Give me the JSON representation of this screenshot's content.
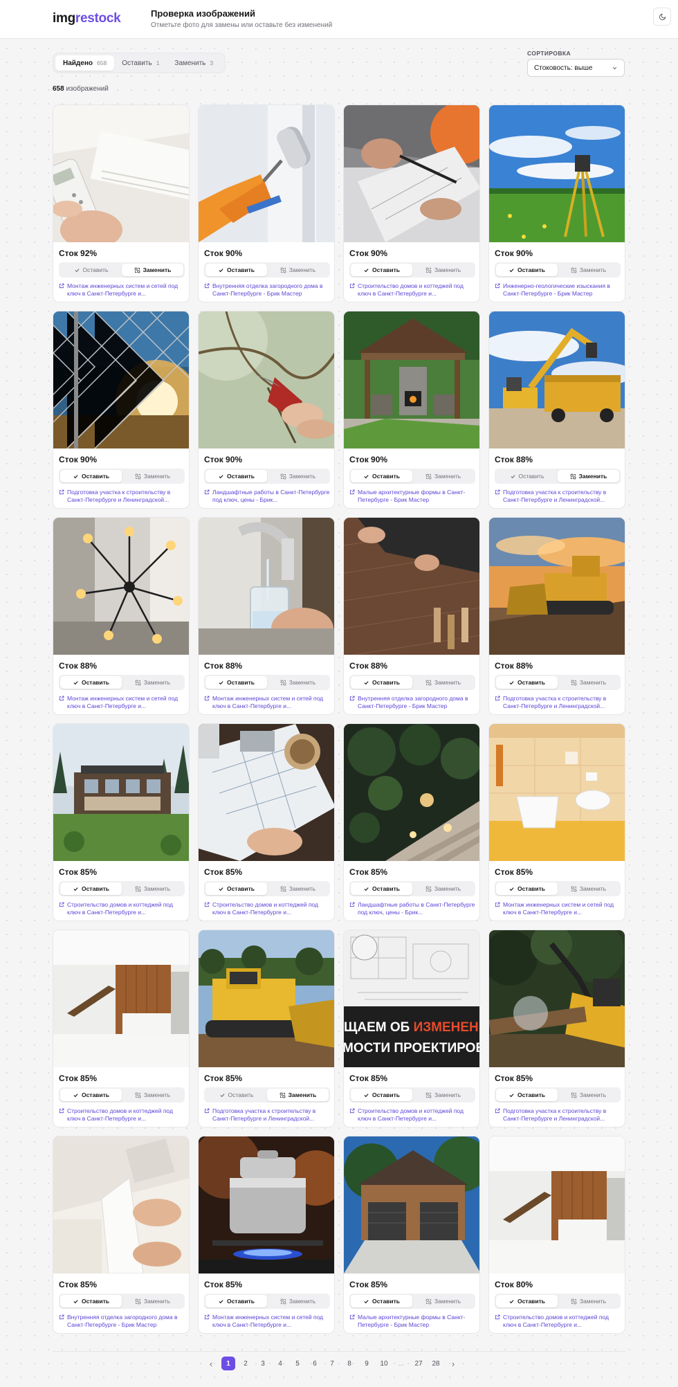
{
  "header": {
    "logo_b": "img",
    "logo_a": "restock",
    "title": "Проверка изображений",
    "subtitle": "Отметьте фото для замены или оставьте без изменений"
  },
  "filters": {
    "tabs": [
      {
        "label": "Найдено",
        "count": "658",
        "active": true
      },
      {
        "label": "Оставить",
        "count": "1",
        "active": false
      },
      {
        "label": "Заменить",
        "count": "3",
        "active": false
      }
    ],
    "sort_label": "СОРТИРОВКА",
    "sort_value": "Стоковость: выше"
  },
  "summary": {
    "count": "658",
    "label": "изображений"
  },
  "labels": {
    "keep": "Оставить",
    "replace": "Заменить"
  },
  "cards": [
    {
      "stock": "Сток 92%",
      "choice": "replace",
      "link": "Монтаж инженерных систем и сетей под ключ в Санкт-Петербурге и...",
      "scene": "ac"
    },
    {
      "stock": "Сток 90%",
      "choice": "keep",
      "link": "Внутренняя отделка загородного дома в Санкт-Петербурге - Брик Мастер",
      "scene": "roller"
    },
    {
      "stock": "Сток 90%",
      "choice": "keep",
      "link": "Строительство домов и коттеджей под ключ в Санкт-Петербурге и...",
      "scene": "plans"
    },
    {
      "stock": "Сток 90%",
      "choice": "keep",
      "link": "Инженерно-геологические изыскания в Санкт-Петербурге - Брик Мастер",
      "scene": "tripod"
    },
    {
      "stock": "Сток 90%",
      "choice": "keep",
      "link": "Подготовка участка к строительству в Санкт-Петербурге и Ленинградской...",
      "scene": "fence"
    },
    {
      "stock": "Сток 90%",
      "choice": "keep",
      "link": "Ландшафтные работы в Санкт-Петербурге под ключ, цены - Брик...",
      "scene": "pruner"
    },
    {
      "stock": "Сток 90%",
      "choice": "keep",
      "link": "Малые архитектурные формы в Санкт-Петербурге - Брик Мастер",
      "scene": "gazebo"
    },
    {
      "stock": "Сток 88%",
      "choice": "replace",
      "link": "Подготовка участка к строительству в Санкт-Петербурге и Ленинградской...",
      "scene": "excavator"
    },
    {
      "stock": "Сток 88%",
      "choice": "keep",
      "link": "Монтаж инженерных систем и сетей под ключ в Санкт-Петербурге и...",
      "scene": "chandelier"
    },
    {
      "stock": "Сток 88%",
      "choice": "keep",
      "link": "Монтаж инженерных систем и сетей под ключ в Санкт-Петербурге и...",
      "scene": "water"
    },
    {
      "stock": "Сток 88%",
      "choice": "keep",
      "link": "Внутренняя отделка загородного дома в Санкт-Петербурге - Брик Мастер",
      "scene": "floor"
    },
    {
      "stock": "Сток 88%",
      "choice": "keep",
      "link": "Подготовка участка к строительству в Санкт-Петербурге и Ленинградской...",
      "scene": "bulldozer"
    },
    {
      "stock": "Сток 85%",
      "choice": "keep",
      "link": "Строительство домов и коттеджей под ключ в Санкт-Петербурге и...",
      "scene": "house"
    },
    {
      "stock": "Сток 85%",
      "choice": "keep",
      "link": "Строительство домов и коттеджей под ключ в Санкт-Петербурге и...",
      "scene": "blueprint"
    },
    {
      "stock": "Сток 85%",
      "choice": "keep",
      "link": "Ландшафтные работы в Санкт-Петербурге под ключ, цены - Брик...",
      "scene": "garden"
    },
    {
      "stock": "Сток 85%",
      "choice": "keep",
      "link": "Монтаж инженерных систем и сетей под ключ в Санкт-Петербурге и...",
      "scene": "bathroom"
    },
    {
      "stock": "Сток 85%",
      "choice": "keep",
      "link": "Строительство домов и коттеджей под ключ в Санкт-Петербурге и...",
      "scene": "interior"
    },
    {
      "stock": "Сток 85%",
      "choice": "replace",
      "link": "Подготовка участка к строительству в Санкт-Петербурге и Ленинградской...",
      "scene": "bulldozer2"
    },
    {
      "stock": "Сток 85%",
      "choice": "keep",
      "link": "Строительство домов и коттеджей под ключ в Санкт-Петербурге и...",
      "scene": "banner",
      "banner_line1a": "ЩАЕМ ОБ ",
      "banner_line1b": "ИЗМЕНЕНИ",
      "banner_line2": "МОСТИ ПРОЕКТИРОВ"
    },
    {
      "stock": "Сток 85%",
      "choice": "keep",
      "link": "Подготовка участка к строительству в Санкт-Петербурге и Ленинградской...",
      "scene": "forestry"
    },
    {
      "stock": "Сток 85%",
      "choice": "keep",
      "link": "Внутренняя отделка загородного дома в Санкт-Петербурге - Брик Мастер",
      "scene": "molding"
    },
    {
      "stock": "Сток 85%",
      "choice": "keep",
      "link": "Монтаж инженерных систем и сетей под ключ в Санкт-Петербурге и...",
      "scene": "pot"
    },
    {
      "stock": "Сток 85%",
      "choice": "keep",
      "link": "Малые архитектурные формы в Санкт-Петербурге - Брик Мастер",
      "scene": "garage"
    },
    {
      "stock": "Сток 80%",
      "choice": "keep",
      "link": "Строительство домов и коттеджей под ключ в Санкт-Петербурге и...",
      "scene": "interior"
    }
  ],
  "pagination": {
    "prev": "‹",
    "next": "›",
    "current": "1",
    "pages": [
      "1",
      "2",
      "3",
      "4",
      "5",
      "6",
      "7",
      "8",
      "9",
      "10",
      "...",
      "27",
      "28"
    ]
  },
  "icons": {
    "theme": "moon-icon",
    "check": "check-icon",
    "replace": "swap-icon",
    "link": "external-link-icon",
    "sort": "chevron-down-icon"
  },
  "colors": {
    "accent": "#6d4de6",
    "link": "#5b45d6"
  }
}
